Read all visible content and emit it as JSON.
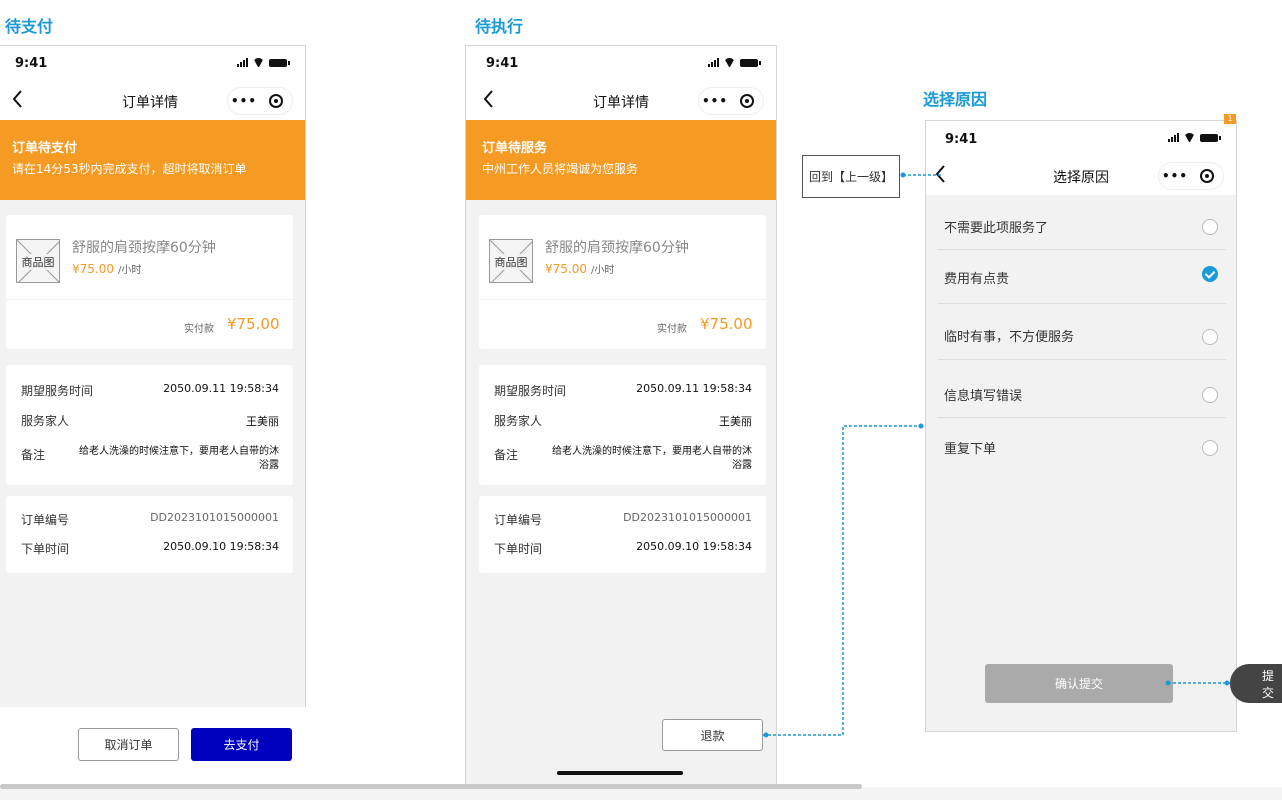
{
  "sections": {
    "pending_payment": "待支付",
    "pending_execution": "待执行",
    "choose_reason": "选择原因"
  },
  "status_time": "9:41",
  "nav": {
    "order_detail": "订单详情",
    "choose_reason": "选择原因",
    "more": "•••"
  },
  "screen1": {
    "banner_title": "订单待支付",
    "banner_sub": "请在14分53秒内完成支付，超时将取消订单",
    "cancel_btn": "取消订单",
    "pay_btn": "去支付"
  },
  "screen2": {
    "banner_title": "订单待服务",
    "banner_sub": "中州工作人员将竭诚为您服务",
    "refund_btn": "退款"
  },
  "product": {
    "image_label": "商品图",
    "name": "舒服的肩颈按摩60分钟",
    "price": "¥75.00",
    "unit": "/小时",
    "paid_label": "实付款",
    "paid_value": "¥75.00"
  },
  "service": {
    "time_label": "期望服务时间",
    "time_value": "2050.09.11  19:58:34",
    "staff_label": "服务家人",
    "staff_value": "王美丽",
    "note_label": "备注",
    "note_value": "给老人洗澡的时候注意下，要用老人自带的沐浴露"
  },
  "order": {
    "no_label": "订单编号",
    "no_value": "DD2023101015000001",
    "time_label": "下单时间",
    "time_value": "2050.09.10  19:58:34"
  },
  "reasons": [
    {
      "label": "不需要此项服务了",
      "checked": false
    },
    {
      "label": "费用有点贵",
      "checked": true
    },
    {
      "label": "临时有事，不方便服务",
      "checked": false
    },
    {
      "label": "信息填写错误",
      "checked": false
    },
    {
      "label": "重复下单",
      "checked": false
    }
  ],
  "confirm_btn": "确认提交",
  "annotation_back": "回到【上一级】",
  "annotation_submit": "提交",
  "badge": "1",
  "colors": {
    "accent": "#1a9ad6",
    "orange": "#f59a23",
    "primary_btn": "#0000bf"
  }
}
